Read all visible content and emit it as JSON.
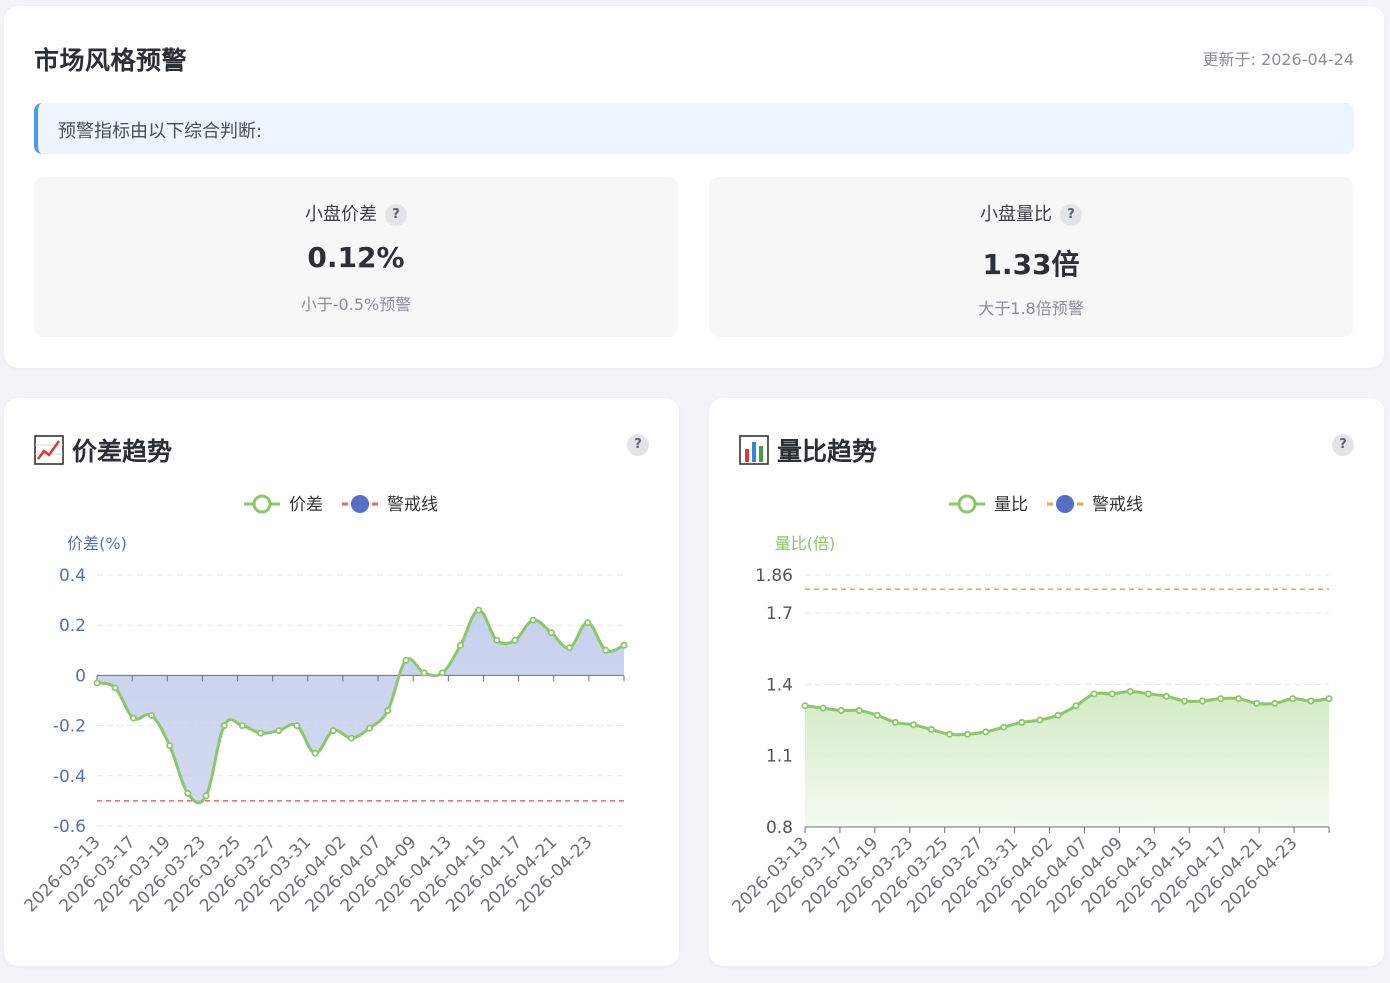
{
  "header": {
    "title": "市场风格预警",
    "updated": "更新于: 2026-04-24"
  },
  "info": {
    "text": "预警指标由以下综合判断:"
  },
  "metrics": [
    {
      "label": "小盘价差",
      "help": "?",
      "value": "0.12%",
      "note": "小于-0.5%预警"
    },
    {
      "label": "小盘量比",
      "help": "?",
      "value": "1.33倍",
      "note": "大于1.8倍预警"
    }
  ],
  "charts": {
    "spread": {
      "icon": "chart-increasing-icon",
      "title": "价差趋势",
      "help": "?"
    },
    "volume": {
      "icon": "bar-chart-icon",
      "title": "量比趋势",
      "help": "?"
    }
  },
  "colors": {
    "green": "#8cc76a",
    "blue_axis": "#5470c6",
    "red_warn": "#ee6666",
    "orange_warn": "#f5a04a",
    "info_border": "#4a98f3"
  },
  "chart_data": [
    {
      "type": "area",
      "title": "",
      "xlabel": "",
      "ylabel": "价差(%)",
      "ylim": [
        -0.6,
        0.4
      ],
      "yticks": [
        "0.4",
        "0.2",
        "0",
        "-0.2",
        "-0.4",
        "-0.6"
      ],
      "xtick_labels": [
        "2026-03-13",
        "2026-03-17",
        "2026-03-19",
        "2026-03-23",
        "2026-03-25",
        "2026-03-27",
        "2026-03-31",
        "2026-04-02",
        "2026-04-07",
        "2026-04-09",
        "2026-04-13",
        "2026-04-15",
        "2026-04-17",
        "2026-04-21",
        "2026-04-23"
      ],
      "legend": {
        "position": "top-center",
        "items": [
          "价差",
          "警戒线"
        ]
      },
      "series": [
        {
          "name": "价差",
          "values": [
            -0.03,
            -0.05,
            -0.17,
            -0.16,
            -0.28,
            -0.47,
            -0.48,
            -0.2,
            -0.2,
            -0.23,
            -0.22,
            -0.2,
            -0.31,
            -0.22,
            -0.25,
            -0.21,
            -0.14,
            0.06,
            0.01,
            0.01,
            0.12,
            0.26,
            0.14,
            0.14,
            0.22,
            0.17,
            0.11,
            0.21,
            0.1,
            0.12
          ]
        },
        {
          "name": "警戒线",
          "value": -0.5
        }
      ],
      "grid": true
    },
    {
      "type": "area",
      "title": "",
      "xlabel": "",
      "ylabel": "量比(倍)",
      "ylim": [
        0.8,
        1.86
      ],
      "yticks": [
        "1.86",
        "1.7",
        "1.4",
        "1.1",
        "0.8"
      ],
      "xtick_labels": [
        "2026-03-13",
        "2026-03-17",
        "2026-03-19",
        "2026-03-23",
        "2026-03-25",
        "2026-03-27",
        "2026-03-31",
        "2026-04-02",
        "2026-04-07",
        "2026-04-09",
        "2026-04-13",
        "2026-04-15",
        "2026-04-17",
        "2026-04-21",
        "2026-04-23"
      ],
      "legend": {
        "position": "top-center",
        "items": [
          "量比",
          "警戒线"
        ]
      },
      "series": [
        {
          "name": "量比",
          "values": [
            1.31,
            1.3,
            1.29,
            1.29,
            1.27,
            1.24,
            1.23,
            1.21,
            1.19,
            1.19,
            1.2,
            1.22,
            1.24,
            1.25,
            1.27,
            1.31,
            1.36,
            1.36,
            1.37,
            1.36,
            1.35,
            1.33,
            1.33,
            1.34,
            1.34,
            1.32,
            1.32,
            1.34,
            1.33,
            1.34
          ]
        },
        {
          "name": "警戒线",
          "value": 1.8
        }
      ],
      "grid": true
    }
  ]
}
